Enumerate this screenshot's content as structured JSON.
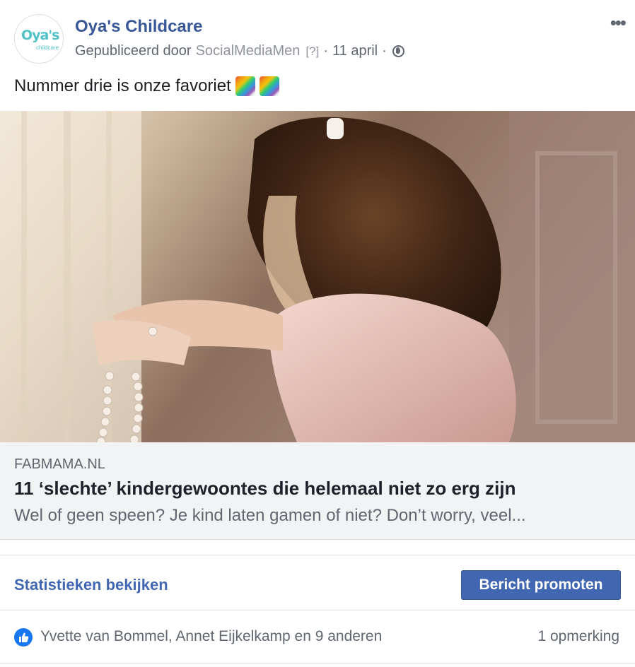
{
  "post": {
    "page_name": "Oya's Childcare",
    "avatar_text": "Oya's",
    "avatar_subtext": "childcare",
    "published_by_label": "Gepubliceerd door",
    "publisher": "SocialMediaMen",
    "help_marker": "[?]",
    "separator": "·",
    "date": "11 april",
    "privacy_icon": "globe-icon",
    "more_icon": "more-options-icon",
    "more_label": "•••",
    "message": "Nummer drie is onze favoriet",
    "emoji": [
      "rainbow",
      "rainbow"
    ]
  },
  "link_preview": {
    "domain": "FABMAMA.NL",
    "title": "11 ‘slechte’ kindergewoontes die helemaal niet zo erg zijn",
    "description": "Wel of geen speen? Je kind laten gamen of niet? Don’t worry, veel..."
  },
  "actions": {
    "stats_label": "Statistieken bekijken",
    "promote_label": "Bericht promoten"
  },
  "engagement": {
    "likes_text": "Yvette van Bommel, Annet Eijkelkamp en 9 anderen",
    "comments_text": "1 opmerking"
  },
  "colors": {
    "link_blue": "#385898",
    "button_blue": "#4267b2",
    "like_blue": "#1877f2"
  }
}
